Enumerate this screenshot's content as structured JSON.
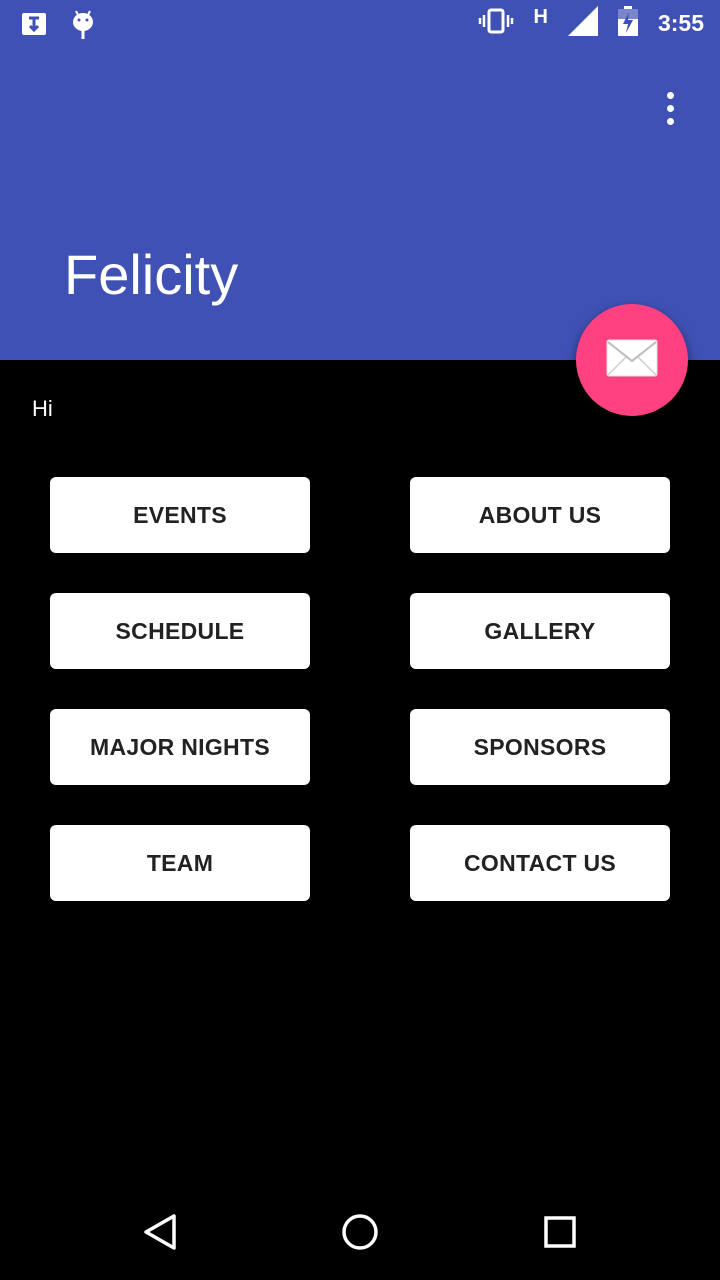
{
  "status_bar": {
    "left_icons": [
      "cloud-download-icon",
      "android-icon"
    ],
    "network_type": "H",
    "time": "3:55",
    "right_icons": [
      "vibrate-icon",
      "signal-icon",
      "battery-charging-icon"
    ]
  },
  "app_bar": {
    "title": "Felicity",
    "menu_icon": "more-vert-icon",
    "color": "#3f51b5"
  },
  "fab": {
    "icon": "mail-icon",
    "color": "#ff4081"
  },
  "main": {
    "greeting": "Hi",
    "buttons": [
      {
        "label": "EVENTS"
      },
      {
        "label": "ABOUT US"
      },
      {
        "label": "SCHEDULE"
      },
      {
        "label": "GALLERY"
      },
      {
        "label": "MAJOR NIGHTS"
      },
      {
        "label": "SPONSORS"
      },
      {
        "label": "TEAM"
      },
      {
        "label": "CONTACT US"
      }
    ]
  },
  "nav_bar": {
    "icons": [
      "back-icon",
      "home-icon",
      "recents-icon"
    ]
  }
}
